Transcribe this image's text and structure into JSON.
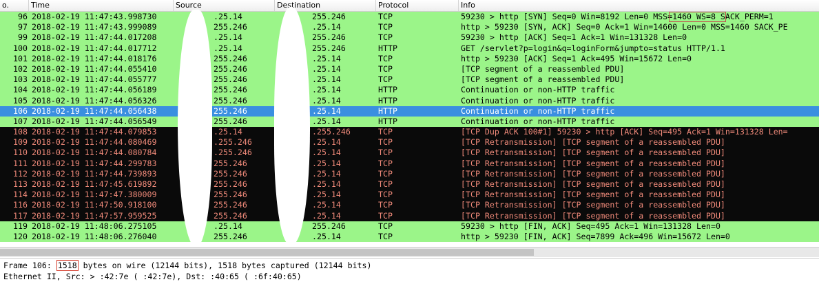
{
  "columns": {
    "no": "o.",
    "time": "Time",
    "source": "Source",
    "destination": "Destination",
    "protocol": "Protocol",
    "info": "Info"
  },
  "packets": [
    {
      "no": "96",
      "time": "2018-02-19 11:47:43.998730",
      "src": "1",
      "dst": "",
      "src_end": ".25.14",
      "dst_end": "255.246",
      "proto": "TCP",
      "info": "59230 > http [SYN] Seq=0 Win=8192 Len=0 MSS=1460 WS=8 SACK_PERM=1",
      "style": "green"
    },
    {
      "no": "97",
      "time": "2018-02-19 11:47:43.999089",
      "src": "1",
      "dst": "",
      "src_end": "255.246",
      "dst_end": ".25.14",
      "proto": "TCP",
      "info": "http > 59230 [SYN, ACK] Seq=0 Ack=1 Win=14600 Len=0 MSS=1460 SACK_PE",
      "style": "green"
    },
    {
      "no": "99",
      "time": "2018-02-19 11:47:44.017208",
      "src": "1",
      "dst": "",
      "src_end": ".25.14",
      "dst_end": "255.246",
      "proto": "TCP",
      "info": "59230 > http [ACK] Seq=1 Ack=1 Win=131328 Len=0",
      "style": "green"
    },
    {
      "no": "100",
      "time": "2018-02-19 11:47:44.017712",
      "src": "1",
      "dst": "",
      "src_end": ".25.14",
      "dst_end": "255.246",
      "proto": "HTTP",
      "info": "GET /servlet?p=login&q=loginForm&jumpto=status HTTP/1.1",
      "style": "green"
    },
    {
      "no": "101",
      "time": "2018-02-19 11:47:44.018176",
      "src": "1",
      "dst": "",
      "src_end": "255.246",
      "dst_end": ".25.14",
      "proto": "TCP",
      "info": "http > 59230 [ACK] Seq=1 Ack=495 Win=15672 Len=0",
      "style": "green"
    },
    {
      "no": "102",
      "time": "2018-02-19 11:47:44.055410",
      "src": "1",
      "dst": "",
      "src_end": "255.246",
      "dst_end": ".25.14",
      "proto": "TCP",
      "info": "[TCP segment of a reassembled PDU]",
      "style": "green"
    },
    {
      "no": "103",
      "time": "2018-02-19 11:47:44.055777",
      "src": "1",
      "dst": "",
      "src_end": "255.246",
      "dst_end": ".25.14",
      "proto": "TCP",
      "info": "[TCP segment of a reassembled PDU]",
      "style": "green"
    },
    {
      "no": "104",
      "time": "2018-02-19 11:47:44.056189",
      "src": "1",
      "dst": "",
      "src_end": "255.246",
      "dst_end": ".25.14",
      "proto": "HTTP",
      "info": "Continuation or non-HTTP traffic",
      "style": "green"
    },
    {
      "no": "105",
      "time": "2018-02-19 11:47:44.056326",
      "src": "1",
      "dst": "1",
      "src_end": "255.246",
      "dst_end": ".25.14",
      "proto": "HTTP",
      "info": "Continuation or non-HTTP traffic",
      "style": "green"
    },
    {
      "no": "106",
      "time": "2018-02-19 11:47:44.056438",
      "src": "",
      "dst": "",
      "src_end": "255.246",
      "dst_end": ".25.14",
      "proto": "HTTP",
      "info": "Continuation or non-HTTP traffic",
      "style": "selected"
    },
    {
      "no": "107",
      "time": "2018-02-19 11:47:44.056549",
      "src": "",
      "dst": "1",
      "src_end": "255.246",
      "dst_end": ".25.14",
      "proto": "HTTP",
      "info": "Continuation or non-HTTP traffic",
      "style": "green"
    },
    {
      "no": "108",
      "time": "2018-02-19 11:47:44.079853",
      "src": "",
      "dst": "",
      "src_end": ".25.14",
      "dst_end": ".255.246",
      "proto": "TCP",
      "info": "[TCP Dup ACK 100#1] 59230 > http [ACK] Seq=495 Ack=1 Win=131328 Len=",
      "style": "black"
    },
    {
      "no": "109",
      "time": "2018-02-19 11:47:44.080469",
      "src": "",
      "dst": "1",
      "src_end": ".255.246",
      "dst_end": ".25.14",
      "proto": "TCP",
      "info": "[TCP Retransmission] [TCP segment of a reassembled PDU]",
      "style": "black"
    },
    {
      "no": "110",
      "time": "2018-02-19 11:47:44.080784",
      "src": "",
      "dst": "1",
      "src_end": ".255.246",
      "dst_end": ".25.14",
      "proto": "TCP",
      "info": "[TCP Retransmission] [TCP segment of a reassembled PDU]",
      "style": "black"
    },
    {
      "no": "111",
      "time": "2018-02-19 11:47:44.299783",
      "src": "",
      "dst": "1",
      "src_end": "255.246",
      "dst_end": ".25.14",
      "proto": "TCP",
      "info": "[TCP Retransmission] [TCP segment of a reassembled PDU]",
      "style": "black"
    },
    {
      "no": "112",
      "time": "2018-02-19 11:47:44.739893",
      "src": "",
      "dst": "1",
      "src_end": "255.246",
      "dst_end": ".25.14",
      "proto": "TCP",
      "info": "[TCP Retransmission] [TCP segment of a reassembled PDU]",
      "style": "black"
    },
    {
      "no": "113",
      "time": "2018-02-19 11:47:45.619892",
      "src": "",
      "dst": "1",
      "src_end": "255.246",
      "dst_end": ".25.14",
      "proto": "TCP",
      "info": "[TCP Retransmission] [TCP segment of a reassembled PDU]",
      "style": "black"
    },
    {
      "no": "114",
      "time": "2018-02-19 11:47:47.380009",
      "src": "",
      "dst": "1",
      "src_end": "255.246",
      "dst_end": ".25.14",
      "proto": "TCP",
      "info": "[TCP Retransmission] [TCP segment of a reassembled PDU]",
      "style": "black"
    },
    {
      "no": "116",
      "time": "2018-02-19 11:47:50.918100",
      "src": "",
      "dst": "1",
      "src_end": "255.246",
      "dst_end": ".25.14",
      "proto": "TCP",
      "info": "[TCP Retransmission] [TCP segment of a reassembled PDU]",
      "style": "black"
    },
    {
      "no": "117",
      "time": "2018-02-19 11:47:57.959525",
      "src": "1",
      "dst": "1",
      "src_end": "255.246",
      "dst_end": ".25.14",
      "proto": "TCP",
      "info": "[TCP Retransmission] [TCP segment of a reassembled PDU]",
      "style": "black"
    },
    {
      "no": "119",
      "time": "2018-02-19 11:48:06.275105",
      "src": "1",
      "dst": "",
      "src_end": ".25.14",
      "dst_end": "255.246",
      "proto": "TCP",
      "info": "59230 > http [FIN, ACK] Seq=495 Ack=1 Win=131328 Len=0",
      "style": "green"
    },
    {
      "no": "120",
      "time": "2018-02-19 11:48:06.276040",
      "src": "1",
      "dst": "",
      "src_end": "255.246",
      "dst_end": ".25.14",
      "proto": "TCP",
      "info": "http > 59230 [FIN, ACK] Seq=7899 Ack=496 Win=15672 Len=0",
      "style": "green"
    }
  ],
  "details": {
    "frame_prefix": "Frame 106: ",
    "frame_bytes": "1518",
    "frame_suffix": " bytes on wire (12144 bits), 1518 bytes captured (12144 bits)",
    "ethernet": "Ethernet II, Src: >             :42:7e (              :42:7e), Dst:                :40:65 (          :6f:40:65)"
  },
  "highlights": {
    "mss_text": "MSS=1460"
  },
  "colors": {
    "good_row": "#9bf589",
    "bad_row": "#0a0a0a",
    "bad_text": "#f08a7a",
    "selected_row": "#3a8fe0",
    "highlight_box": "#c0504d"
  }
}
